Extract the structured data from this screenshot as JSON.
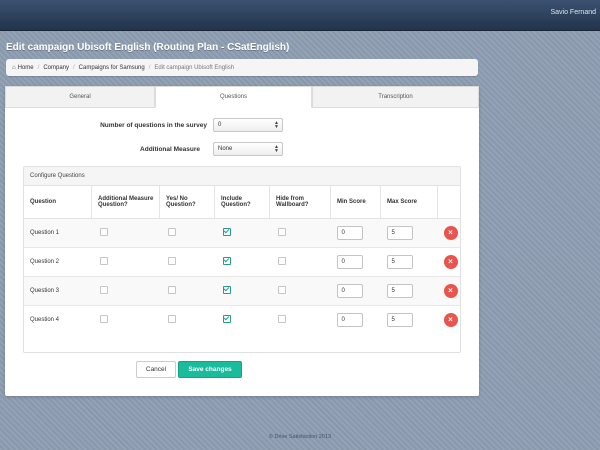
{
  "topbar": {
    "user": "Savio Fernand"
  },
  "page": {
    "title": "Edit campaign Ubisoft English (Routing Plan - CSatEnglish)"
  },
  "breadcrumb": {
    "home": "Home",
    "company": "Company",
    "campaigns": "Campaigns for Samsung",
    "current": "Edit campaign Ubisoft English"
  },
  "tabs": {
    "general": "General",
    "questions": "Questions",
    "transcription": "Transcription"
  },
  "form": {
    "num_questions_label": "Number of questions in the survey",
    "num_questions_value": "0",
    "additional_measure_label": "Additional Measure",
    "additional_measure_value": "None"
  },
  "configure": {
    "header": "Configure Questions",
    "columns": {
      "question": "Question",
      "additional": "Additional Measure Question?",
      "yesno": "Yes/ No Question?",
      "include": "Include Question?",
      "hide": "Hide from Wallboard?",
      "min": "Min Score",
      "max": "Max Score"
    },
    "rows": [
      {
        "name": "Question 1",
        "additional": false,
        "yesno": false,
        "include": true,
        "hide": false,
        "min": "0",
        "max": "5"
      },
      {
        "name": "Question 2",
        "additional": false,
        "yesno": false,
        "include": true,
        "hide": false,
        "min": "0",
        "max": "5"
      },
      {
        "name": "Question 3",
        "additional": false,
        "yesno": false,
        "include": true,
        "hide": false,
        "min": "0",
        "max": "5"
      },
      {
        "name": "Question 4",
        "additional": false,
        "yesno": false,
        "include": true,
        "hide": false,
        "min": "0",
        "max": "5"
      }
    ]
  },
  "actions": {
    "cancel": "Cancel",
    "save": "Save changes"
  },
  "footer": {
    "text": "© Drive Satisfaction 2013"
  },
  "icons": {
    "home": "home-icon",
    "delete": "remove-icon",
    "select": "updown-arrows-icon"
  },
  "colors": {
    "accent": "#1abc9c",
    "delete": "#e9544e",
    "topbar": "#2b3e58"
  }
}
